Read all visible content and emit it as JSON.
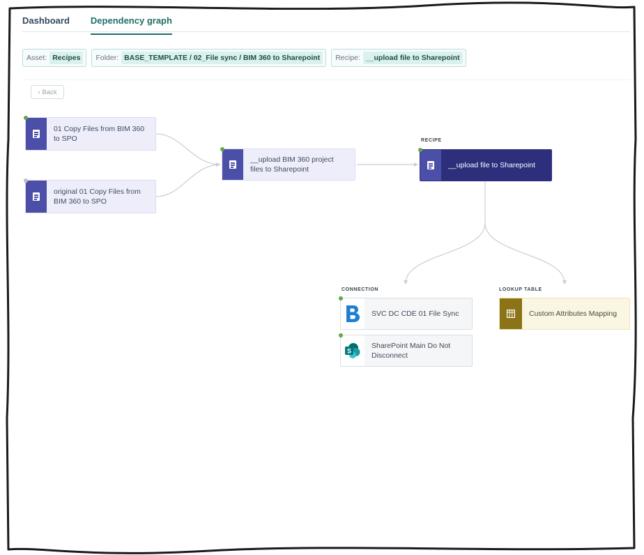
{
  "tabs": [
    {
      "label": "Dashboard",
      "active": false
    },
    {
      "label": "Dependency graph",
      "active": true
    }
  ],
  "filters": {
    "asset": {
      "label": "Asset:",
      "value": "Recipes"
    },
    "folder": {
      "label": "Folder:",
      "value": "BASE_TEMPLATE / 02_File sync / BIM 360 to Sharepoint"
    },
    "recipe": {
      "label": "Recipe:",
      "value": "__upload file to Sharepoint"
    }
  },
  "back_button": {
    "label": "Back",
    "icon": "chevron-left-icon"
  },
  "graph": {
    "callers": [
      {
        "label": "01 Copy Files from BIM 360 to SPO",
        "status": "running",
        "icon": "recipe-icon"
      },
      {
        "label": "original 01 Copy Files from BIM 360 to SPO",
        "status": "stopped",
        "icon": "recipe-icon"
      }
    ],
    "intermediate": {
      "label": "__upload BIM 360 project files to Sharepoint",
      "status": "running",
      "icon": "recipe-icon"
    },
    "recipe_section_label": "RECIPE",
    "main_recipe": {
      "label": "__upload file to Sharepoint",
      "status": "running",
      "icon": "recipe-icon"
    },
    "connection_section_label": "CONNECTION",
    "connections": [
      {
        "label": "SVC DC CDE 01 File Sync",
        "icon": "bim360-logo-icon",
        "status": "connected"
      },
      {
        "label": "SharePoint Main Do Not Disconnect",
        "icon": "sharepoint-logo-icon",
        "status": "connected"
      }
    ],
    "lookup_section_label": "LOOKUP TABLE",
    "lookup_tables": [
      {
        "label": "Custom Attributes Mapping",
        "icon": "table-icon"
      }
    ]
  },
  "colors": {
    "accent": "#1f6f68",
    "recipe_node": "#eeeefb",
    "recipe_icon": "#4c4fa8",
    "main_recipe": "#2d2f7c",
    "lookup_icon": "#8c7316",
    "status_green": "#5fa840"
  }
}
